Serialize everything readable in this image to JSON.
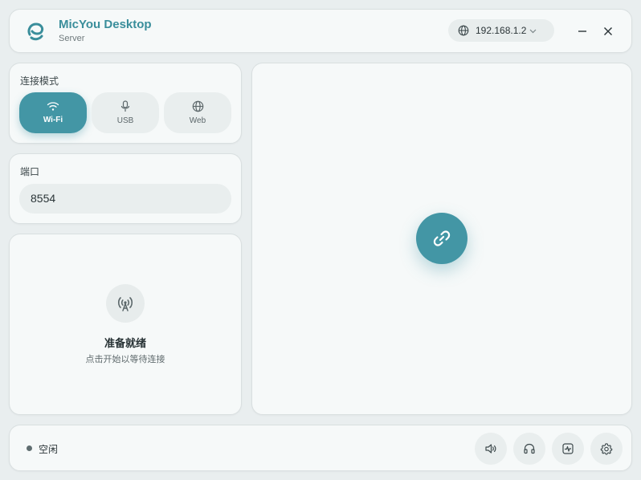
{
  "app": {
    "title": "MicYou Desktop",
    "subtitle": "Server",
    "ip_address": "192.168.1.2",
    "accent_color": "#4396a5"
  },
  "connection_mode": {
    "label": "连接模式",
    "options": [
      {
        "label": "Wi-Fi",
        "icon": "wifi-icon",
        "active": true
      },
      {
        "label": "USB",
        "icon": "microphone-icon",
        "active": false
      },
      {
        "label": "Web",
        "icon": "globe-icon",
        "active": false
      }
    ]
  },
  "port": {
    "label": "端口",
    "value": "8554"
  },
  "status_panel": {
    "icon": "broadcast-tower-icon",
    "title": "准备就绪",
    "subtitle": "点击开始以等待连接"
  },
  "main": {
    "connect_icon": "link-icon"
  },
  "status_bar": {
    "state": "空闲",
    "tools": [
      "speaker-icon",
      "headphones-icon",
      "activity-icon",
      "settings-icon"
    ]
  }
}
